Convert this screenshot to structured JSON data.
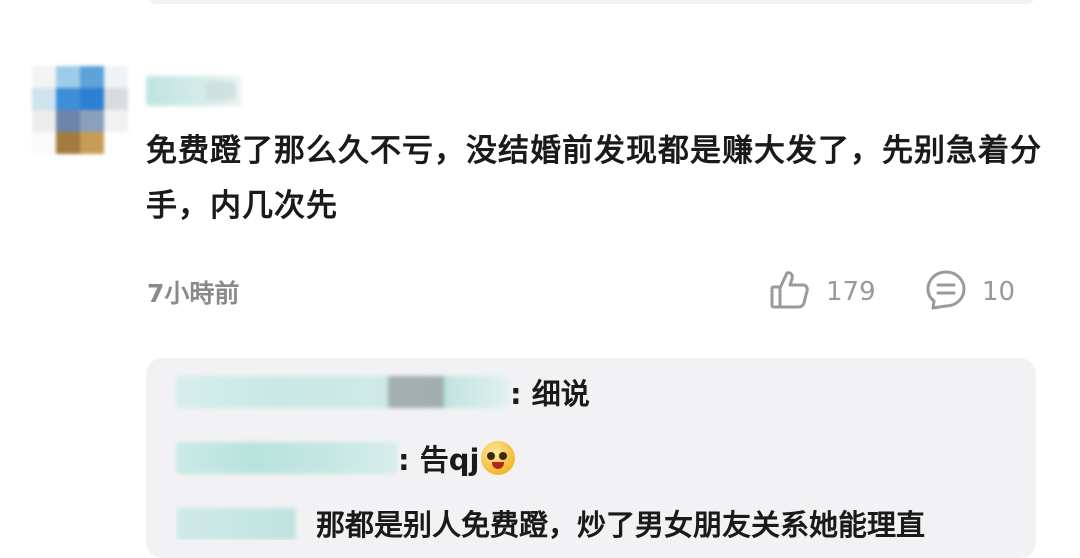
{
  "comment": {
    "text": "免费蹬了那么久不亏，没结婚前发现都是赚大发了，先别急着分手，内几次先",
    "time": "7小時前",
    "like_icon": "thumbs-up-icon",
    "like_count": "179",
    "reply_icon": "comment-bubble-icon",
    "reply_count": "10"
  },
  "replies": [
    {
      "text": ": 细说"
    },
    {
      "text": ": 告qj",
      "emoji": "laughing-emoji-icon"
    },
    {
      "text": "那都是别人免费蹬，炒了男女朋友关系她能理直"
    }
  ],
  "colors": {
    "text": "#1a1a1a",
    "muted": "#8a8a8a",
    "card_bg": "#f2f2f4",
    "blur_teal": "#bfe3e0"
  }
}
